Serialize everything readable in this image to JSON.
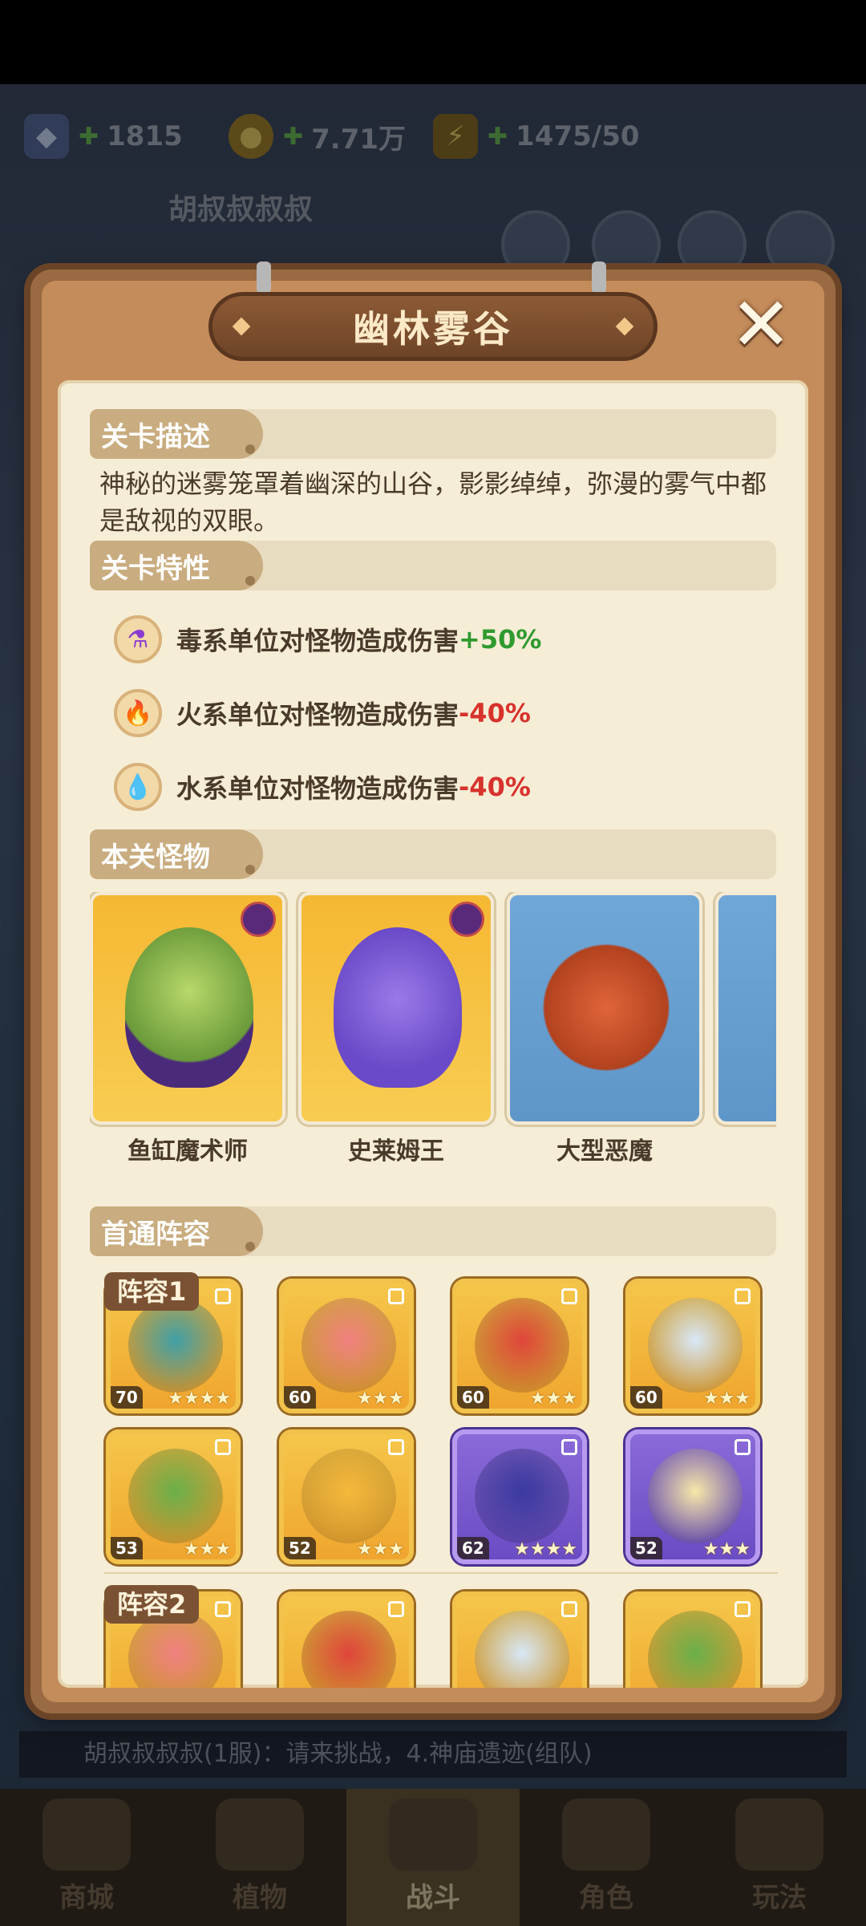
{
  "resources": [
    {
      "icon": "diamond-icon",
      "value": "1815"
    },
    {
      "icon": "coin-icon",
      "value": "7.71万"
    },
    {
      "icon": "energy-icon",
      "value": "1475/50"
    }
  ],
  "player": {
    "name": "胡叔叔叔叔"
  },
  "chat": {
    "text": "胡叔叔叔叔(1服)：请来挑战，4.神庙遗迹(组队)"
  },
  "nav": [
    {
      "label": "商城"
    },
    {
      "label": "植物"
    },
    {
      "label": "战斗"
    },
    {
      "label": "角色"
    },
    {
      "label": "玩法"
    }
  ],
  "dialog": {
    "title": "幽林雾谷",
    "close": "✕",
    "sections": {
      "desc_title": "关卡描述",
      "desc_text": "神秘的迷雾笼罩着幽深的山谷，影影绰绰，弥漫的雾气中都是敌视的双眼。",
      "traits_title": "关卡特性",
      "monsters_title": "本关怪物",
      "lineup_title": "首通阵容"
    },
    "traits": [
      {
        "icon": "poison-flask-icon",
        "text": "毒系单位对怪物造成伤害",
        "value": "+50%",
        "color": "#2f9a2f"
      },
      {
        "icon": "fire-icon",
        "text": "火系单位对怪物造成伤害",
        "value": "-40%",
        "color": "#d8322c"
      },
      {
        "icon": "water-drop-icon",
        "text": "水系单位对怪物造成伤害",
        "value": "-40%",
        "color": "#d8322c"
      }
    ],
    "monsters": [
      {
        "name": "鱼缸魔术师",
        "bg": "gold",
        "boss": true
      },
      {
        "name": "史莱姆王",
        "bg": "gold",
        "boss": true
      },
      {
        "name": "大型恶魔",
        "bg": "blue",
        "boss": false
      },
      {
        "name": "",
        "bg": "blue",
        "boss": false
      }
    ],
    "lineups": [
      {
        "label": "阵容1",
        "heroes": [
          {
            "level": "70",
            "stars": "★★★★",
            "frame": "gold"
          },
          {
            "level": "60",
            "stars": "★★★",
            "frame": "gold"
          },
          {
            "level": "60",
            "stars": "★★★",
            "frame": "gold"
          },
          {
            "level": "60",
            "stars": "★★★",
            "frame": "gold"
          },
          {
            "level": "53",
            "stars": "★★★",
            "frame": "gold"
          },
          {
            "level": "52",
            "stars": "★★★",
            "frame": "gold"
          },
          {
            "level": "62",
            "stars": "★★★★",
            "frame": "purple"
          },
          {
            "level": "52",
            "stars": "★★★",
            "frame": "purple"
          }
        ]
      },
      {
        "label": "阵容2",
        "heroes": [
          {
            "level": "",
            "stars": "",
            "frame": "gold"
          },
          {
            "level": "",
            "stars": "",
            "frame": "gold"
          },
          {
            "level": "",
            "stars": "",
            "frame": "gold"
          },
          {
            "level": "",
            "stars": "",
            "frame": "gold"
          }
        ]
      }
    ]
  }
}
